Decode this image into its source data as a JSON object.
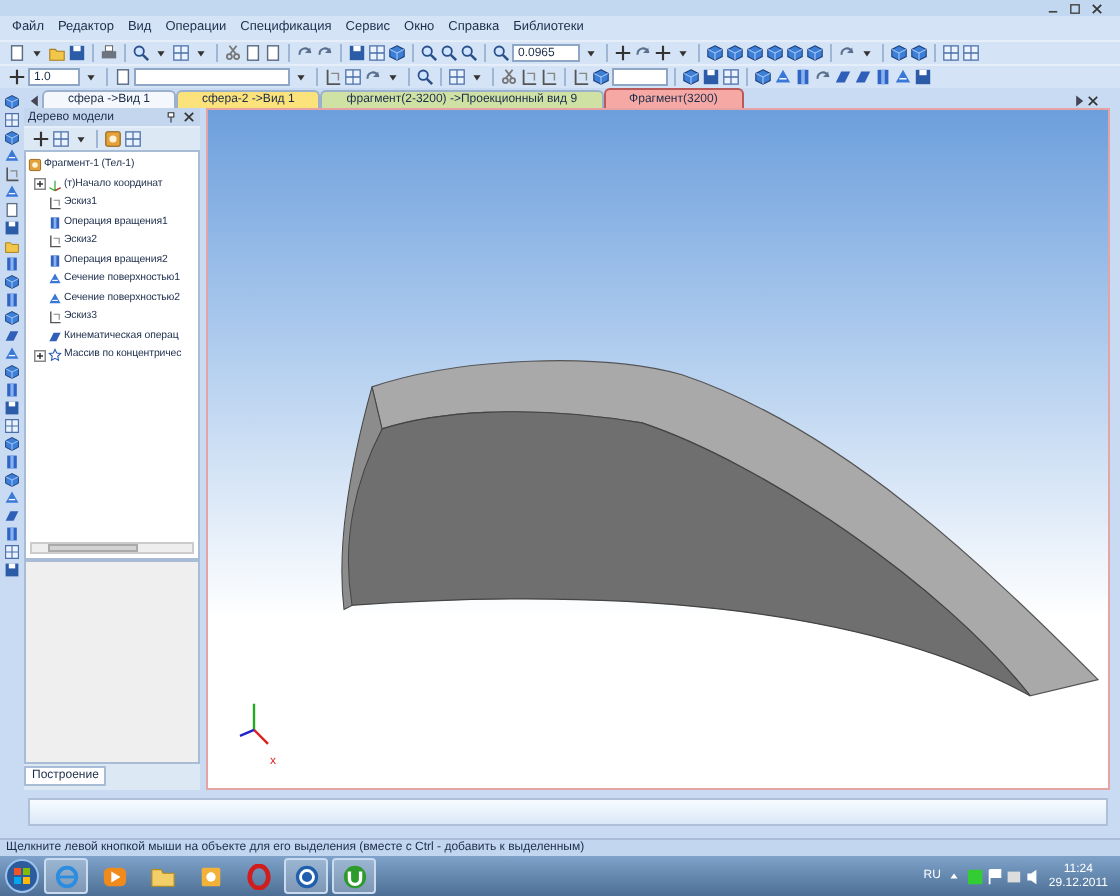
{
  "menu": [
    "Файл",
    "Редактор",
    "Вид",
    "Операции",
    "Спецификация",
    "Сервис",
    "Окно",
    "Справка",
    "Библиотеки"
  ],
  "toolbar": {
    "zoom_value": "0.0965"
  },
  "toolbar2": {
    "line_step": "1.0"
  },
  "document_tabs": [
    {
      "label": "сфера ->Вид 1",
      "selected": false,
      "color": "#f4f7fb"
    },
    {
      "label": "сфера-2 ->Вид 1",
      "selected": false,
      "color": "#fbe27a"
    },
    {
      "label": "фрагмент(2-3200) ->Проекционный вид 9",
      "selected": false,
      "color": "#cfe2a4"
    },
    {
      "label": "Фрагмент(3200)",
      "selected": true,
      "color": "#f6a9a4"
    }
  ],
  "model_tree": {
    "title": "Дерево модели",
    "items": [
      {
        "label": "Фрагмент-1 (Тел-1)",
        "kind": "part",
        "children": [
          {
            "label": "(т)Начало координат",
            "kind": "origin",
            "expanded": false
          },
          {
            "label": "Эскиз1",
            "kind": "sketch"
          },
          {
            "label": "Операция вращения1",
            "kind": "rotation"
          },
          {
            "label": "Эскиз2",
            "kind": "sketch"
          },
          {
            "label": "Операция вращения2",
            "kind": "rotation"
          },
          {
            "label": "Сечение поверхностью1",
            "kind": "section"
          },
          {
            "label": "Сечение поверхностью2",
            "kind": "section"
          },
          {
            "label": "Эскиз3",
            "kind": "sketch"
          },
          {
            "label": "Кинематическая операц",
            "kind": "kinematic"
          },
          {
            "label": "Массив по концентричес",
            "kind": "array",
            "expanded": false
          }
        ]
      }
    ],
    "bottom_tab": "Построение"
  },
  "viewport": {
    "axis_label": "x"
  },
  "status_bar": "Щелкните левой кнопкой мыши на объекте для его выделения (вместе с Ctrl - добавить к выделенным)",
  "taskbar": {
    "apps": [
      {
        "kind": "browser",
        "open": true
      },
      {
        "kind": "media",
        "open": false
      },
      {
        "kind": "folder",
        "open": false
      },
      {
        "kind": "mail",
        "open": false
      },
      {
        "kind": "opera",
        "open": false
      },
      {
        "kind": "cad",
        "open": true
      },
      {
        "kind": "torrent",
        "open": true
      }
    ],
    "language": "RU",
    "time": "11:24",
    "date": "29.12.2011"
  }
}
